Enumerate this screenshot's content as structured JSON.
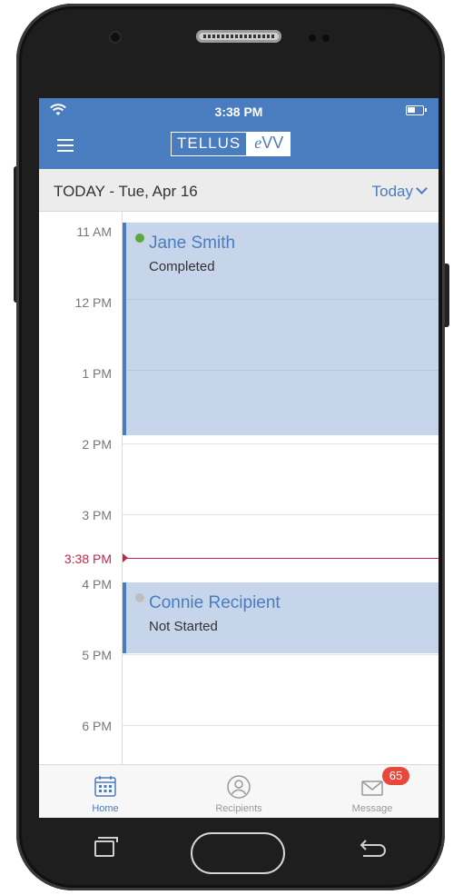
{
  "status_bar": {
    "time": "3:38 PM",
    "battery_level": 0.5
  },
  "header": {
    "logo_left": "TELLUS",
    "logo_right_italic": "e",
    "logo_right": "VV"
  },
  "date_bar": {
    "date": "TODAY - Tue, Apr 16",
    "today_button": "Today"
  },
  "calendar": {
    "hours": [
      "11 AM",
      "12 PM",
      "1 PM",
      "2 PM",
      "3 PM",
      "4 PM",
      "5 PM",
      "6 PM"
    ],
    "now_label": "3:38 PM",
    "events": [
      {
        "name": "Jane Smith",
        "status": "Completed",
        "dot_color": "#5aa83c"
      },
      {
        "name": "Connie Recipient",
        "status": "Not Started",
        "dot_color": "#bdbdbd"
      }
    ]
  },
  "tabs": [
    {
      "label": "Home",
      "icon": "calendar-icon",
      "active": true
    },
    {
      "label": "Recipients",
      "icon": "person-icon",
      "active": false
    },
    {
      "label": "Message",
      "icon": "mail-icon",
      "active": false,
      "badge": "65"
    }
  ],
  "colors": {
    "primary": "#4a7cc0",
    "event_fill": "#c7d5ea",
    "now_line": "#c2274b",
    "badge": "#e8473c"
  }
}
